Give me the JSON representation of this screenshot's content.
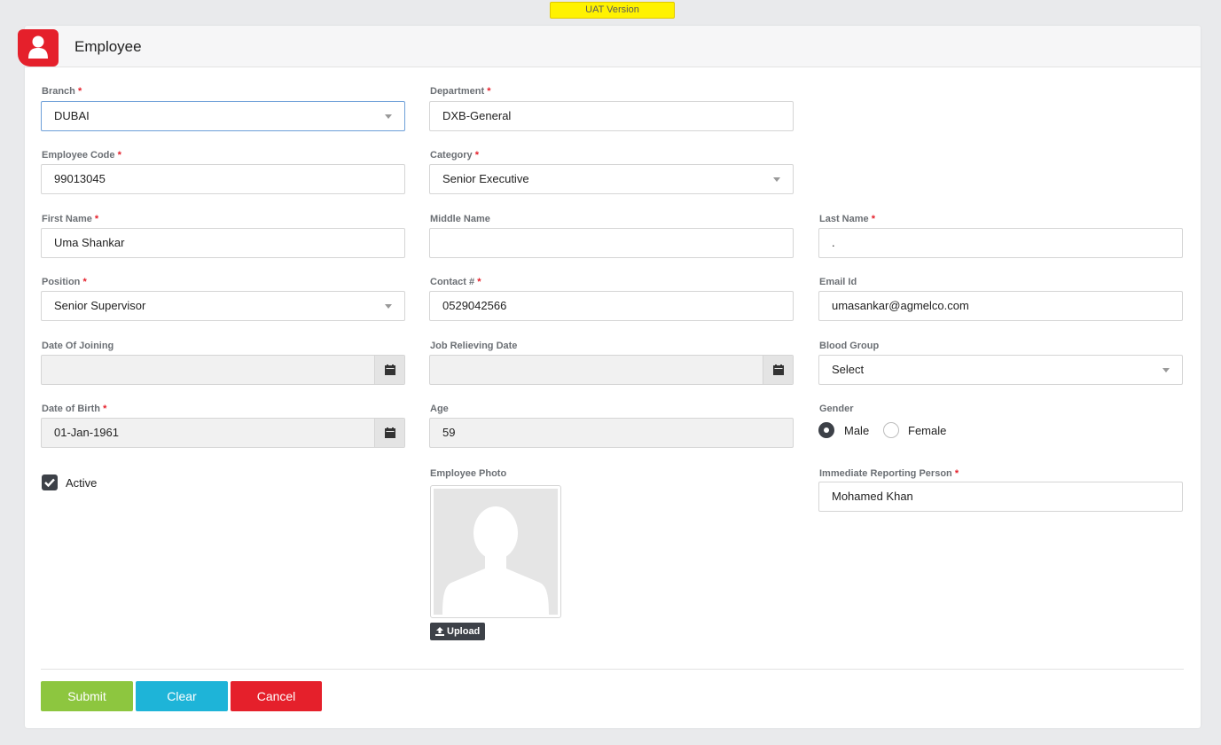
{
  "banner": "UAT Version",
  "header": {
    "title": "Employee"
  },
  "colors": {
    "accent": "#e5202b",
    "submit": "#8dc63f",
    "clear": "#1eb4d8",
    "cancel": "#e5202b",
    "dark": "#3d4148"
  },
  "fields": {
    "branch": {
      "label": "Branch",
      "value": "DUBAI"
    },
    "department": {
      "label": "Department",
      "value": "DXB-General"
    },
    "employee_code": {
      "label": "Employee Code",
      "value": "99013045"
    },
    "category": {
      "label": "Category",
      "value": "Senior Executive"
    },
    "first_name": {
      "label": "First Name",
      "value": "Uma Shankar"
    },
    "middle_name": {
      "label": "Middle Name",
      "value": ""
    },
    "last_name": {
      "label": "Last Name",
      "value": "."
    },
    "position": {
      "label": "Position",
      "value": "Senior Supervisor"
    },
    "contact": {
      "label": "Contact #",
      "value": "0529042566"
    },
    "email": {
      "label": "Email Id",
      "value": "umasankar@agmelco.com"
    },
    "date_of_joining": {
      "label": "Date Of Joining",
      "value": ""
    },
    "job_relieving_date": {
      "label": "Job Relieving Date",
      "value": ""
    },
    "blood_group": {
      "label": "Blood Group",
      "value": "Select"
    },
    "date_of_birth": {
      "label": "Date of Birth",
      "value": "01-Jan-1961"
    },
    "age": {
      "label": "Age",
      "value": "59"
    },
    "gender": {
      "label": "Gender",
      "options": [
        "Male",
        "Female"
      ],
      "selected": "Male"
    },
    "active": {
      "label": "Active",
      "checked": true
    },
    "employee_photo": {
      "label": "Employee Photo",
      "upload_label": "Upload"
    },
    "reporting_person": {
      "label": "Immediate Reporting Person",
      "value": "Mohamed Khan"
    }
  },
  "required_mark": "*",
  "icons": {
    "calendar": "calendar-icon",
    "dropdown": "caret-down-icon",
    "upload": "upload-icon",
    "check": "check-icon",
    "user": "user-icon"
  },
  "buttons": {
    "submit": "Submit",
    "clear": "Clear",
    "cancel": "Cancel"
  }
}
